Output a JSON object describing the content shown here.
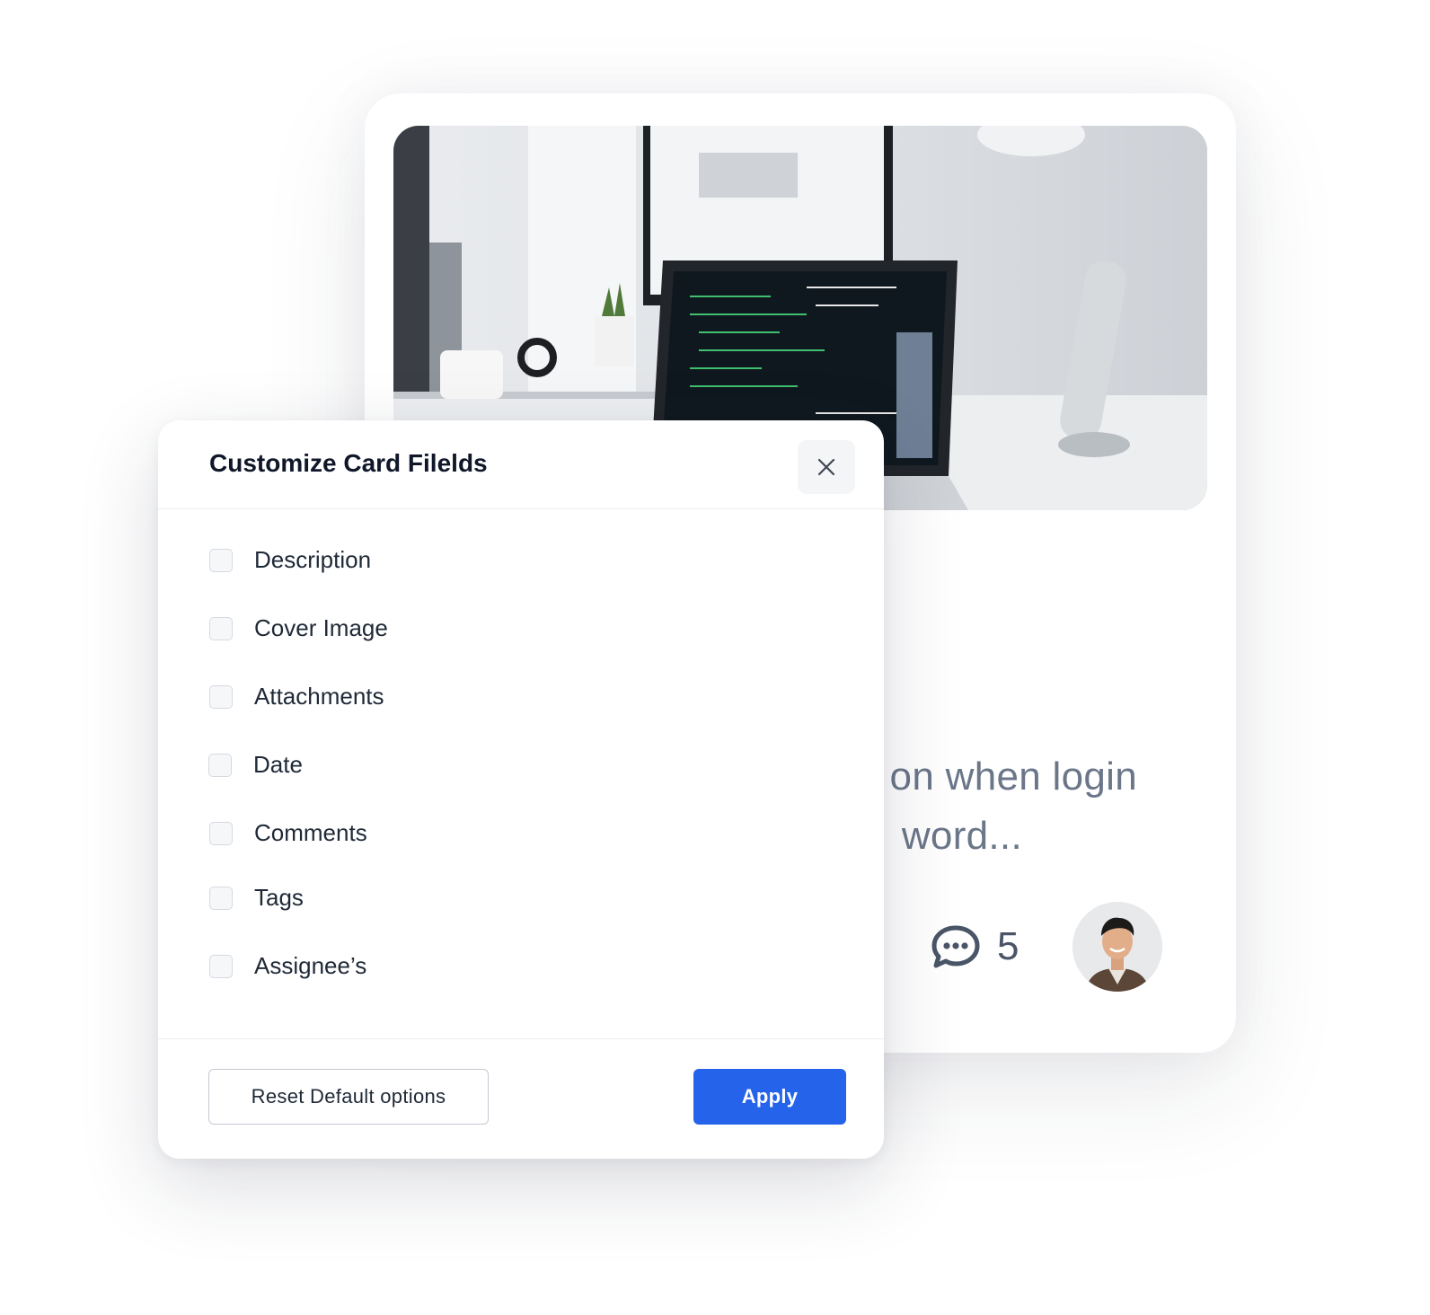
{
  "card": {
    "cover_image_alt": "Desk with laptop and monitor",
    "text_line1": "on when login",
    "text_line2": "word...",
    "comment_icon": "comment-bubble-icon",
    "comment_count": "5",
    "avatar_icon": "user-avatar"
  },
  "modal": {
    "title": "Customize Card Filelds",
    "close_icon": "close-icon",
    "fields": [
      {
        "label": "Description",
        "checked": false
      },
      {
        "label": "Cover Image",
        "checked": false
      },
      {
        "label": "Attachments",
        "checked": false
      },
      {
        "label": "Date",
        "checked": false
      },
      {
        "label": "Comments",
        "checked": false
      },
      {
        "label": "Tags",
        "checked": false
      },
      {
        "label": "Assignee’s",
        "checked": false
      }
    ],
    "reset_label": "Reset Default options",
    "apply_label": "Apply"
  },
  "colors": {
    "accent": "#2563eb",
    "title_text": "#0f1729",
    "muted_text": "#6b7689"
  }
}
